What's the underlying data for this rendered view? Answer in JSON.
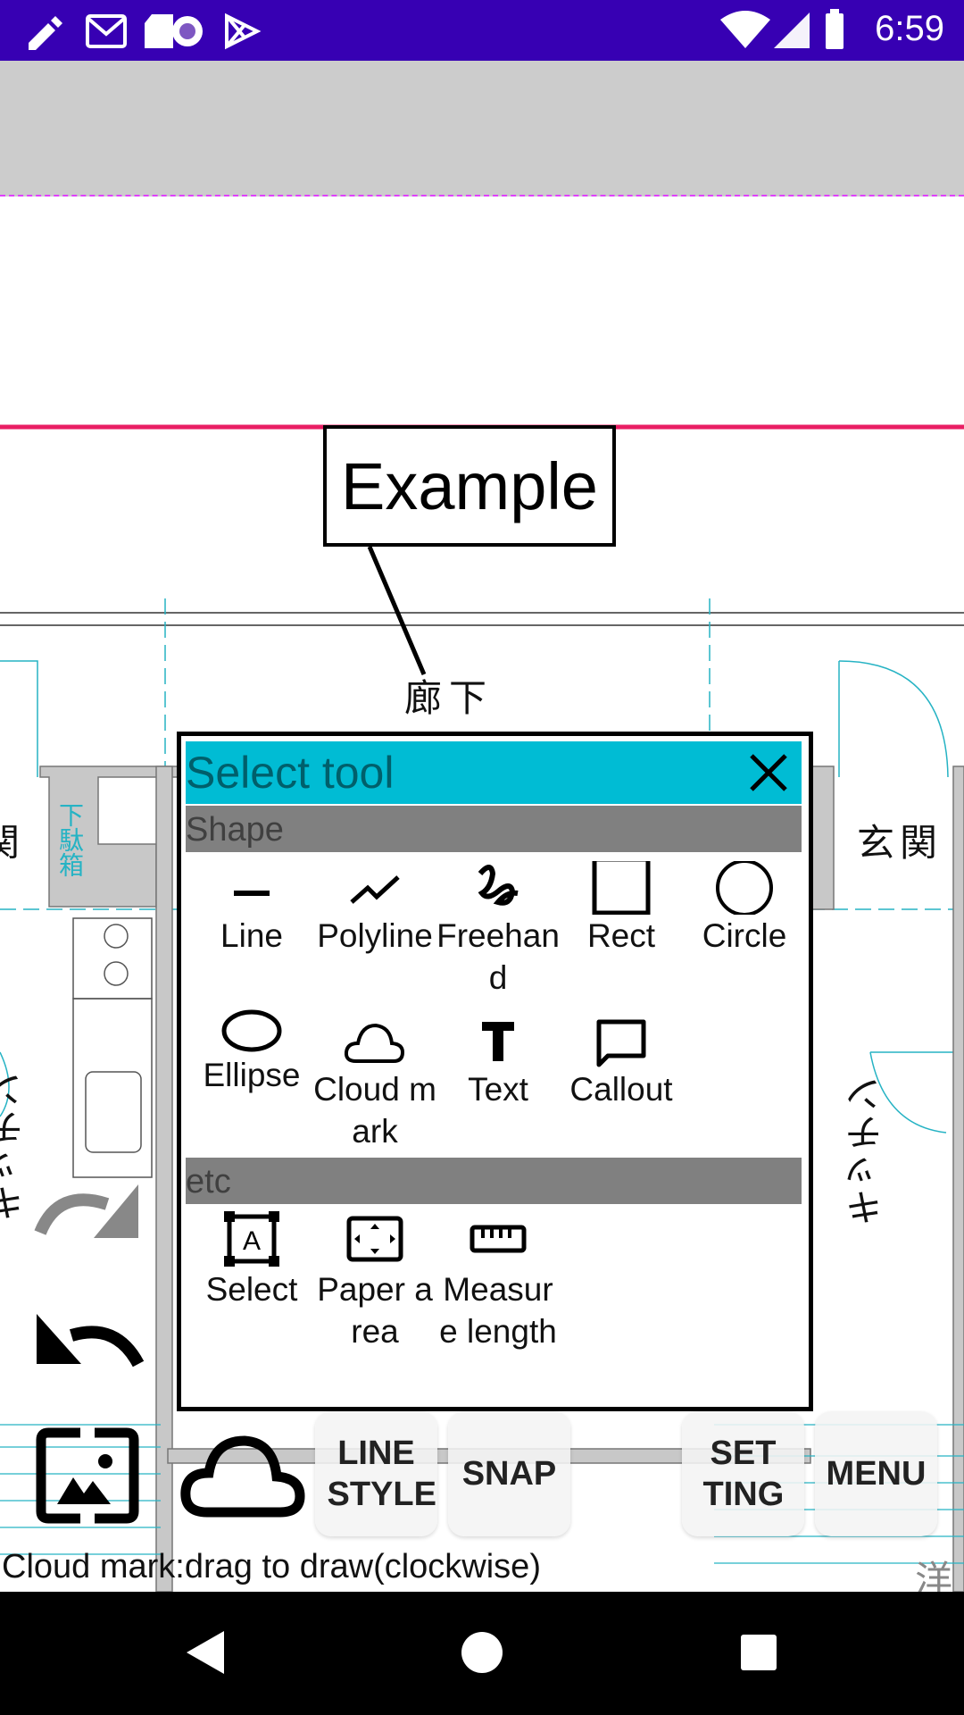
{
  "status_bar": {
    "time": "6:59",
    "left_icons": [
      "pencil-icon",
      "gmail-icon",
      "sd-card-icon",
      "record-icon",
      "play-store-icon"
    ],
    "right_icons": [
      "wifi-icon",
      "signal-icon",
      "battery-icon"
    ],
    "color": "#3700b3"
  },
  "canvas": {
    "callout_text": "Example",
    "plan_labels": {
      "corridor": "廊下",
      "entrance_left": "関",
      "entrance_right": "玄関",
      "shoe_box": "下駄箱",
      "kitchen_left": "キッチン",
      "kitchen_right": "キッチン",
      "western_room": "洋"
    }
  },
  "dialog": {
    "title": "Select tool",
    "header_color": "#00bcd4",
    "sections": [
      {
        "label": "Shape",
        "tools": [
          {
            "label": "Line",
            "icon": "line-icon"
          },
          {
            "label": "Polyline",
            "icon": "polyline-icon"
          },
          {
            "label": "Freehand",
            "icon": "freehand-icon"
          },
          {
            "label": "Rect",
            "icon": "rect-icon"
          },
          {
            "label": "Circle",
            "icon": "circle-icon"
          },
          {
            "label": "Ellipse",
            "icon": "ellipse-icon"
          },
          {
            "label": "Cloud mark",
            "icon": "cloud-icon"
          },
          {
            "label": "Text",
            "icon": "text-icon"
          },
          {
            "label": "Callout",
            "icon": "callout-icon"
          }
        ]
      },
      {
        "label": "etc",
        "tools": [
          {
            "label": "Select",
            "icon": "select-icon"
          },
          {
            "label": "Paper area",
            "icon": "paper-area-icon"
          },
          {
            "label": "Measure length",
            "icon": "ruler-icon"
          }
        ]
      }
    ]
  },
  "toolbar": {
    "line_style": "LINE STYLE",
    "snap": "SNAP",
    "setting": "SET TING",
    "menu": "MENU"
  },
  "hint": "Cloud mark:drag to draw(clockwise)"
}
